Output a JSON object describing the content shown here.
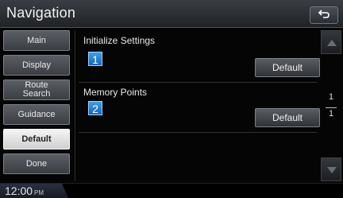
{
  "header": {
    "title": "Navigation"
  },
  "menu": {
    "items": [
      {
        "label": "Main"
      },
      {
        "label": "Display"
      },
      {
        "label_line1": "Route",
        "label_line2": "Search"
      },
      {
        "label": "Guidance"
      },
      {
        "label": "Default",
        "active": true
      },
      {
        "label": "Done"
      }
    ]
  },
  "content": {
    "sections": [
      {
        "title": "Initialize Settings",
        "badge": "1",
        "button_label": "Default"
      },
      {
        "title": "Memory Points",
        "badge": "2",
        "button_label": "Default"
      }
    ]
  },
  "scroll": {
    "current_page": "1",
    "total_pages": "1"
  },
  "status": {
    "time": "12:00",
    "ampm": "PM"
  },
  "colors": {
    "badge": "#1f7fd6",
    "active_menu": "#eaeaea"
  }
}
